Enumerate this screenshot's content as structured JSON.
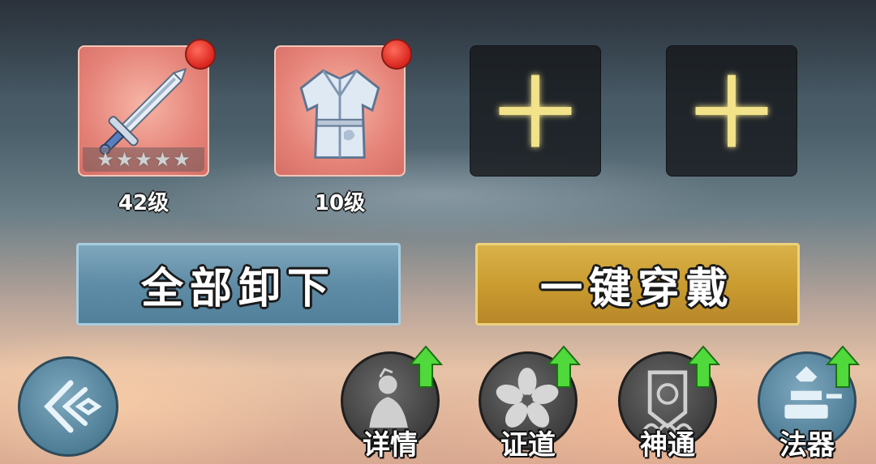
{
  "equipment_slots": [
    {
      "type": "weapon",
      "icon": "sword-icon",
      "level_label": "42级",
      "stars": 5,
      "has_alert": true
    },
    {
      "type": "armor",
      "icon": "robe-icon",
      "level_label": "10级",
      "has_alert": true
    },
    {
      "type": "empty",
      "icon": "plus-icon"
    },
    {
      "type": "empty",
      "icon": "plus-icon"
    }
  ],
  "buttons": {
    "unequip_all": "全部卸下",
    "equip_all": "一键穿戴"
  },
  "nav": [
    {
      "label": "详情",
      "icon": "character-icon",
      "has_upgrade": true
    },
    {
      "label": "证道",
      "icon": "flower-icon",
      "has_upgrade": true
    },
    {
      "label": "神通",
      "icon": "talisman-icon",
      "has_upgrade": true
    },
    {
      "label": "法器",
      "icon": "artifact-icon",
      "has_upgrade": true
    }
  ],
  "colors": {
    "slot_filled": "#e6847a",
    "alert_dot": "#d9261f",
    "button_blue": "#5f8ca6",
    "button_gold": "#c99a2e",
    "upgrade_arrow": "#4fd93a"
  }
}
